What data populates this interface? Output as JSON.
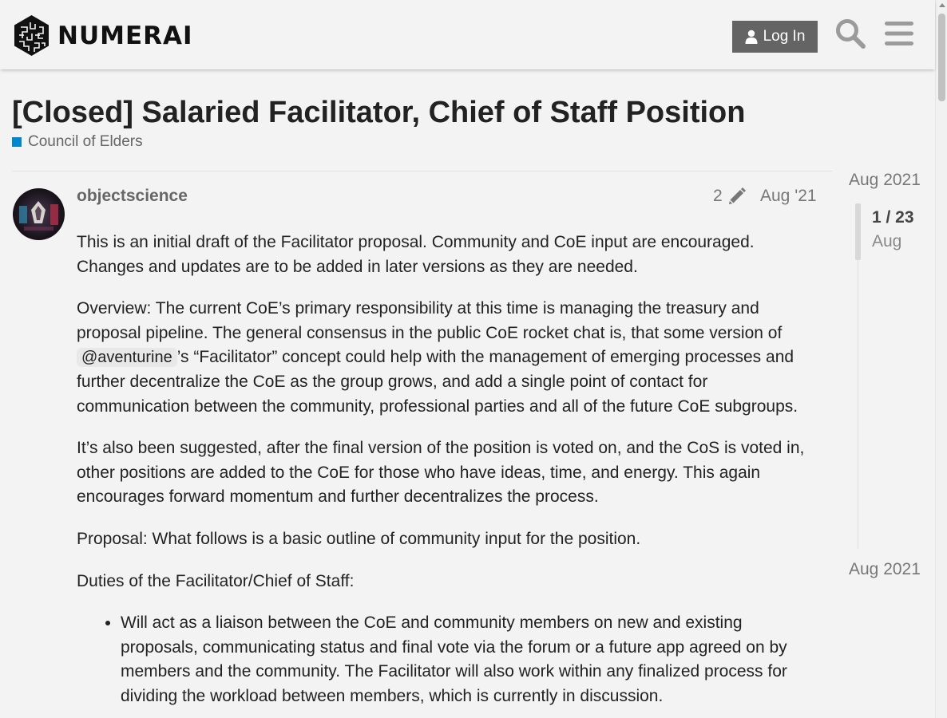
{
  "header": {
    "brand": "NUMERAI",
    "login_label": "Log In"
  },
  "topic": {
    "title": "[Closed] Salaried Facilitator, Chief of Staff Position",
    "category": "Council of Elders",
    "category_color": "#0088cc"
  },
  "post": {
    "username": "objectscience",
    "edit_count": "2",
    "date": "Aug '21",
    "p1": "This is an initial draft of the Facilitator proposal. Community and CoE input are encouraged. Changes and updates are to be added in later versions as they are needed.",
    "p2_before": "Overview: The current CoE’s primary responsibility at this time is managing the treasury and proposal pipeline. The general consensus in the public CoE rocket chat is, that some version of ",
    "p2_mention": "@aventurine",
    "p2_after": "’s “Facilitator” concept could help with the management of emerging processes and further decentralize the CoE as the group grows, and add a single point of contact for communication between the community, professional parties and all of the future CoE subgroups.",
    "p3": "It’s also been suggested, after the final version of the position is voted on, and the CoS is voted in, other positions are added to the CoE for those who have ideas, time, and energy. This again encourages forward momentum and further decentralizes the process.",
    "p4": "Proposal: What follows is a basic outline of community input for the position.",
    "p5": "Duties of the Facilitator/Chief of Staff:",
    "bullets": [
      "Will act as a liaison between the CoE and community members on new and existing proposals, communicating status and final vote via the forum or a future app agreed on by members and the community. The Facilitator will also work within any finalized process for dividing the workload between members, which is currently in discussion."
    ]
  },
  "timeline": {
    "start": "Aug 2021",
    "position": "1 / 23",
    "month": "Aug",
    "end": "Aug 2021"
  }
}
